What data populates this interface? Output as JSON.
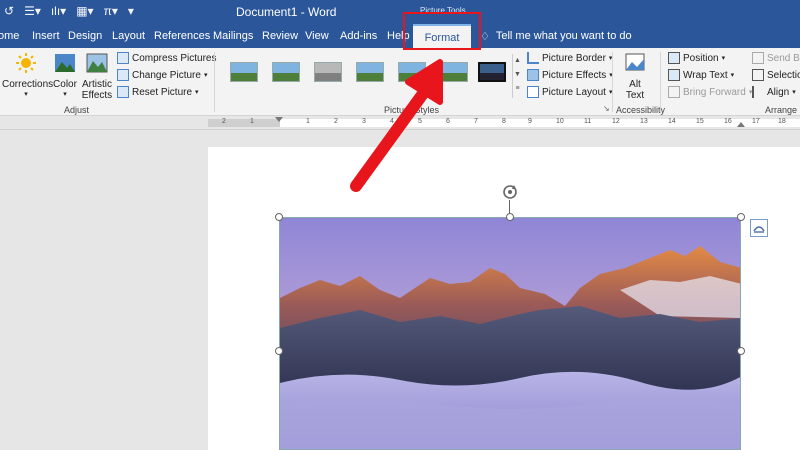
{
  "titlebar": {
    "document_title": "Document1 - Word",
    "context_label": "Picture Tools"
  },
  "tabs": [
    {
      "label": "ome"
    },
    {
      "label": "Insert"
    },
    {
      "label": "Design"
    },
    {
      "label": "Layout"
    },
    {
      "label": "References"
    },
    {
      "label": "Mailings"
    },
    {
      "label": "Review"
    },
    {
      "label": "View"
    },
    {
      "label": "Add-ins"
    },
    {
      "label": "Help"
    },
    {
      "label": "Format"
    }
  ],
  "tell_me": "Tell me what you want to do",
  "ribbon": {
    "adjust": {
      "corrections": "Corrections",
      "color": "Color",
      "artistic_line1": "Artistic",
      "artistic_line2": "Effects",
      "compress": "Compress Pictures",
      "change": "Change Picture",
      "reset": "Reset Picture",
      "group_label": "Adjust"
    },
    "styles": {
      "border": "Picture Border",
      "effects": "Picture Effects",
      "layout": "Picture Layout",
      "group_label": "Picture Styles"
    },
    "accessibility": {
      "alt_line1": "Alt",
      "alt_line2": "Text",
      "group_label": "Accessibility"
    },
    "arrange": {
      "position": "Position",
      "wrap": "Wrap Text",
      "bring": "Bring Forward",
      "send": "Send Ba",
      "selection": "Selectio",
      "align": "Align",
      "group_label": "Arrange"
    }
  },
  "ruler_numbers": [
    "2",
    "1",
    "1",
    "2",
    "3",
    "4",
    "5",
    "6",
    "7",
    "8",
    "9",
    "10",
    "11",
    "12",
    "13",
    "14",
    "15",
    "16",
    "17",
    "18"
  ],
  "colors": {
    "word_blue": "#2b579a",
    "annotation_red": "#e8151c"
  }
}
